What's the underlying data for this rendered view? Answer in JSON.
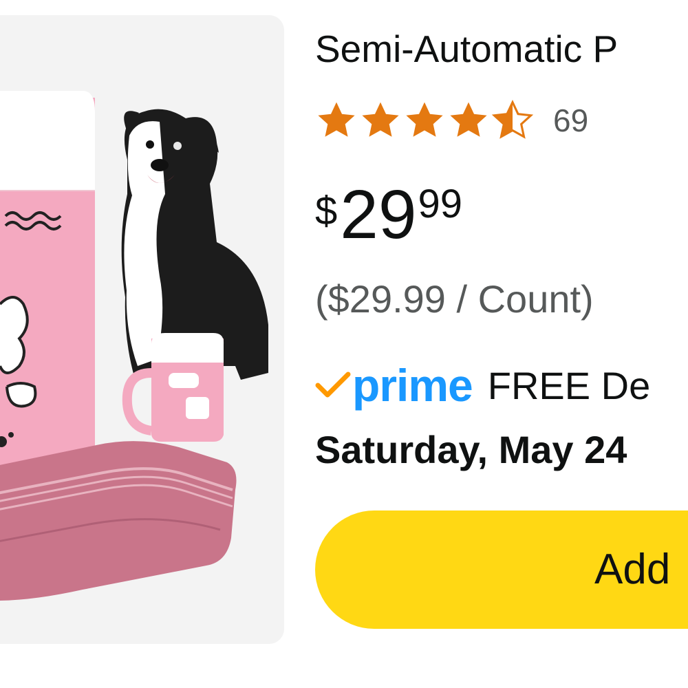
{
  "product": {
    "title": "Semi-Automatic P",
    "image_alt_icon": "product-image",
    "rating": {
      "value": 4.5,
      "max": 5,
      "count": "69",
      "star_color": "#e47911"
    },
    "price": {
      "symbol": "$",
      "whole": "29",
      "fraction": "99",
      "unit_price": "($29.99 / Count)"
    },
    "delivery": {
      "prime_label": "prime",
      "prime_color": "#1a98ff",
      "check_color": "#ff9900",
      "free_label": "FREE De",
      "date": "Saturday, May 24"
    },
    "cart_button": {
      "label": "Add",
      "color": "#ffd814"
    }
  }
}
